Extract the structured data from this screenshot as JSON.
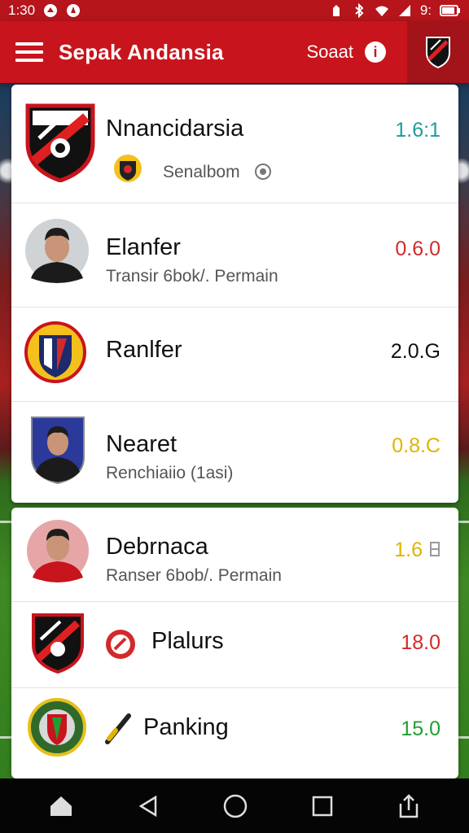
{
  "status_bar": {
    "time": "1:30 ",
    "battery": "9:"
  },
  "app_bar": {
    "title": "Sepak Andansia",
    "search_label": "Soaat",
    "info_glyph": "i"
  },
  "list1": [
    {
      "name": "Nnancidarsia",
      "sub": "Senalbom",
      "score": "1.6:1",
      "score_color": "#1c9c9a",
      "avatar": "club-shield-icon"
    },
    {
      "name": "Elanfer",
      "sub": "Transir 6bok/. Permain",
      "score": "0.6.0",
      "score_color": "#d22a2a",
      "avatar": "player-photo"
    },
    {
      "name": "Ranlfer",
      "sub": "",
      "score": "2.0.G",
      "score_color": "#111111",
      "avatar": "club-badge-icon"
    },
    {
      "name": "Nearet",
      "sub": "Renchiaiio (1asi)",
      "score": "0.8.C",
      "score_color": "#e2b300",
      "avatar": "player-photo"
    }
  ],
  "list2": [
    {
      "name": "Debrnaca",
      "sub": "Ranser 6bob/. Permain",
      "score": "1.6",
      "score_color": "#e2b300",
      "avatar": "player-photo"
    },
    {
      "name": "Plalurs",
      "sub": "",
      "score": "18.0",
      "score_color": "#d22a2a",
      "avatar": "club-shield-icon"
    },
    {
      "name": "Panking",
      "sub": "",
      "score": "15.0",
      "score_color": "#1f9e32",
      "avatar": "club-badge-icon"
    }
  ],
  "colors": {
    "primary": "#c8141c",
    "primary_dark": "#b5151b"
  }
}
